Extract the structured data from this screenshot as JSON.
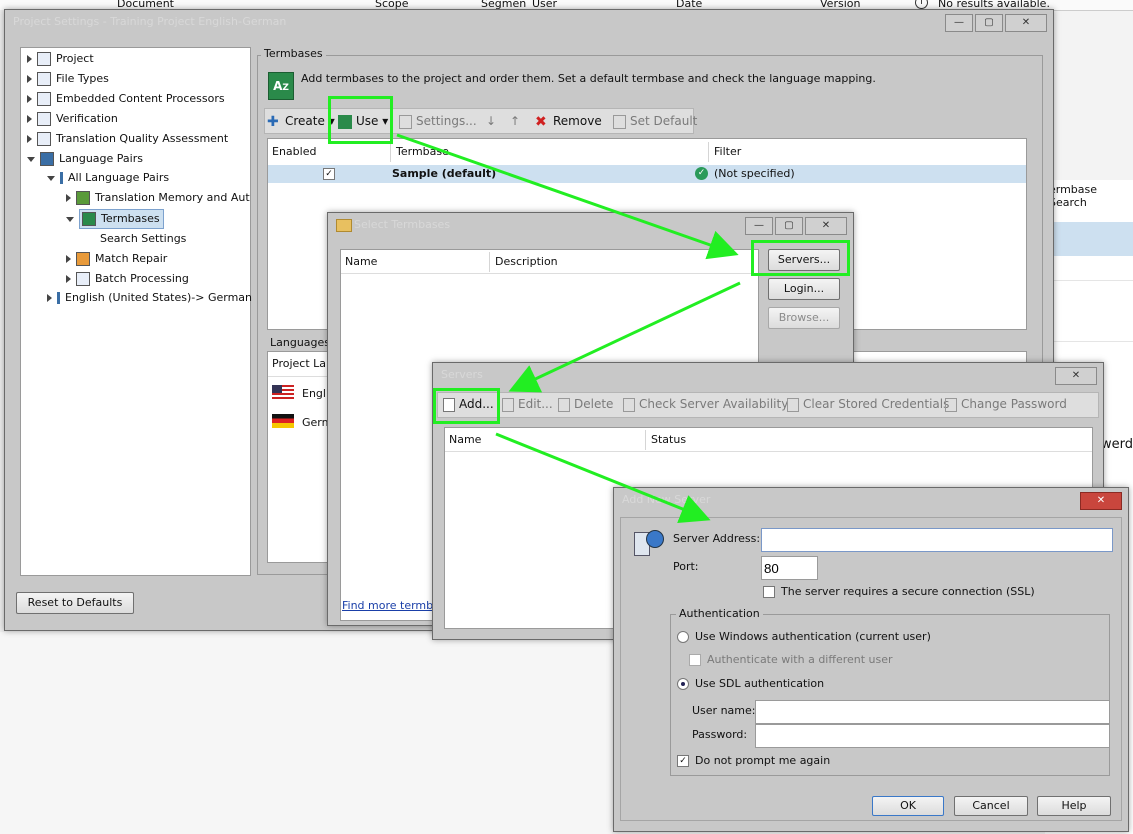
{
  "background": {
    "headers": [
      "Document",
      "Scope",
      "Segmen",
      "User",
      "Date",
      "Version"
    ],
    "no_results": "No results available.",
    "termbase_search": "ermbase Search",
    "side_text": "werd"
  },
  "project_settings": {
    "title": "Project Settings - Training Project English-German",
    "tree": [
      {
        "label": "Project"
      },
      {
        "label": "File Types"
      },
      {
        "label": "Embedded Content Processors"
      },
      {
        "label": "Verification"
      },
      {
        "label": "Translation Quality Assessment"
      },
      {
        "label": "Language Pairs"
      },
      {
        "label": "All Language Pairs"
      },
      {
        "label": "Translation Memory and Aut"
      },
      {
        "label": "Termbases"
      },
      {
        "label": "Search Settings"
      },
      {
        "label": "Match Repair"
      },
      {
        "label": "Batch Processing"
      },
      {
        "label": "English (United States)-> German"
      }
    ],
    "reset_button": "Reset to Defaults",
    "termbases_group": "Termbases",
    "description": "Add termbases to the project and order them. Set a default termbase and check the language mapping.",
    "toolbar": {
      "create": "Create",
      "use": "Use",
      "settings": "Settings...",
      "remove": "Remove",
      "set_default": "Set Default"
    },
    "grid": {
      "headers": [
        "Enabled",
        "Termbase",
        "Filter"
      ],
      "rows": [
        {
          "termbase": "Sample (default)",
          "filter": "(Not specified)"
        }
      ]
    },
    "languages_label": "Languages",
    "project_language_header": "Project Lan",
    "languages": [
      "Englis",
      "Germ"
    ],
    "find_more": "Find more termbase"
  },
  "select_termbases": {
    "title": "Select Termbases",
    "headers": [
      "Name",
      "Description"
    ],
    "servers_button": "Servers...",
    "login_button": "Login...",
    "browse_button": "Browse..."
  },
  "servers": {
    "title": "Servers",
    "toolbar": {
      "add": "Add...",
      "edit": "Edit...",
      "delete": "Delete",
      "check": "Check Server Availability",
      "clear": "Clear Stored Credentials",
      "change": "Change Password"
    },
    "headers": [
      "Name",
      "Status"
    ]
  },
  "add_server": {
    "title": "Add New Server",
    "server_address_label": "Server Address:",
    "server_address_value": "",
    "port_label": "Port:",
    "port_value": "80",
    "ssl_label": "The server requires a secure connection (SSL)",
    "auth_group": "Authentication",
    "windows_auth": "Use Windows authentication (current user)",
    "different_user": "Authenticate with a different user",
    "sdl_auth": "Use SDL authentication",
    "username_label": "User name:",
    "password_label": "Password:",
    "do_not_prompt": "Do not prompt me again",
    "ok": "OK",
    "cancel": "Cancel",
    "help": "Help"
  },
  "colors": {
    "highlight": "#22ee22",
    "selected_row": "#cde0f0",
    "window_bg": "#c8c8c8"
  }
}
